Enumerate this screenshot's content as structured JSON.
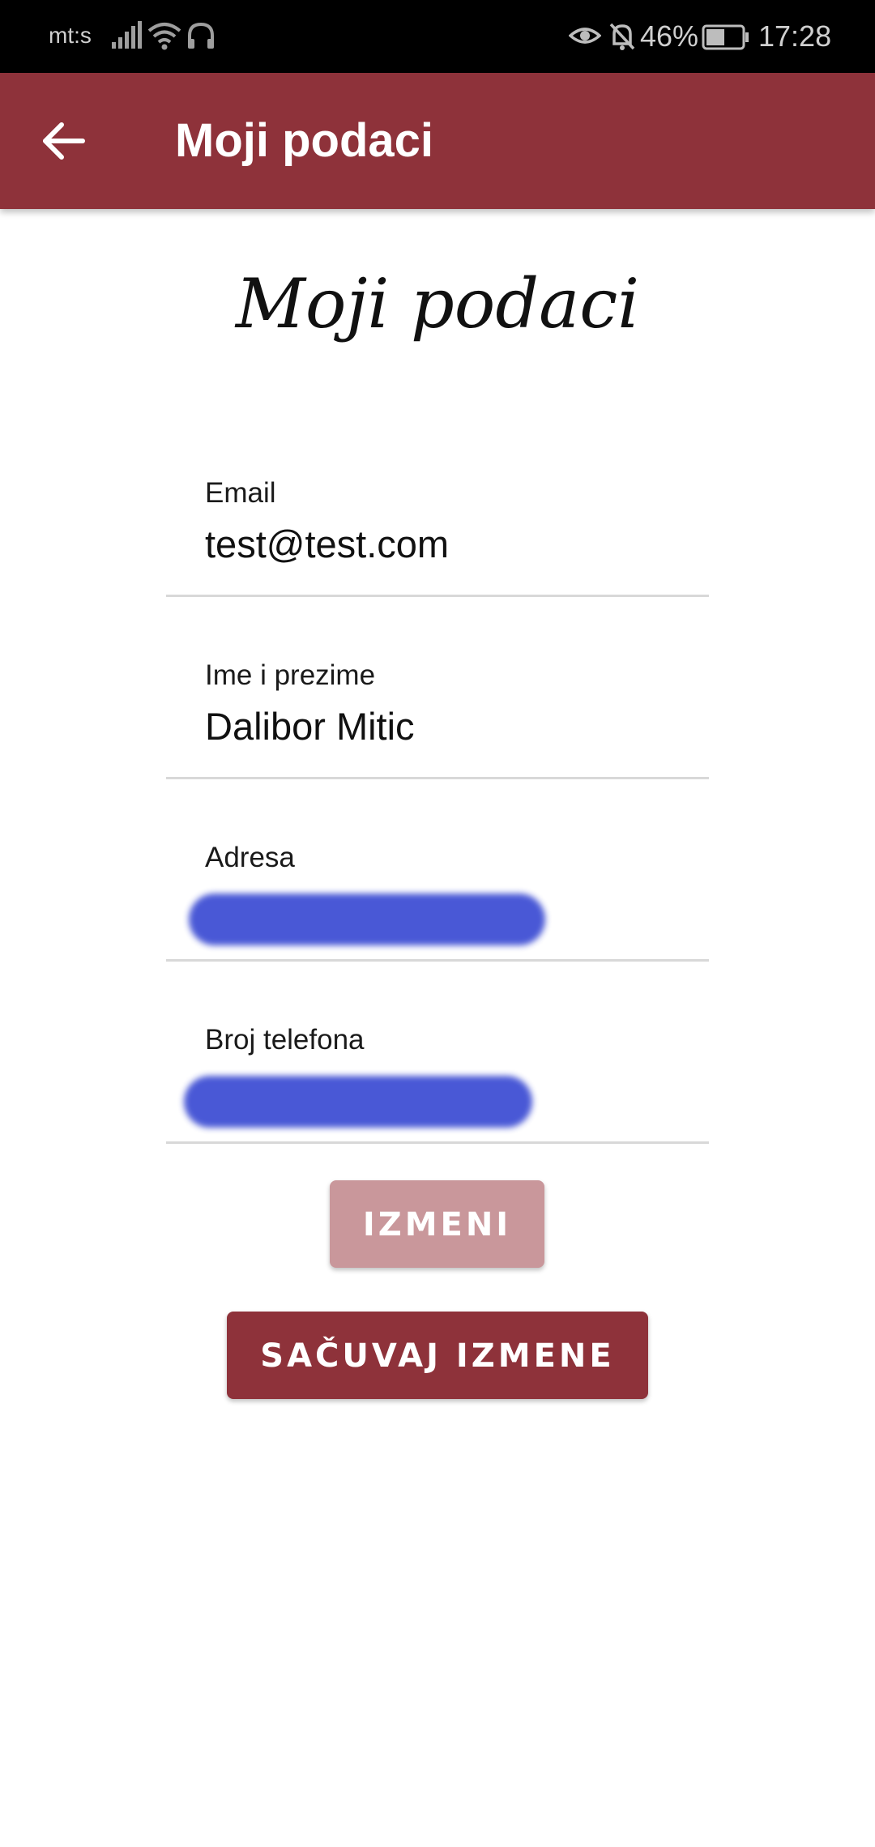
{
  "status_bar": {
    "carrier": "mt:s",
    "battery_percent": "46%",
    "time": "17:28",
    "icons": [
      "signal-icon",
      "wifi-icon",
      "headset-icon",
      "eye-icon",
      "bell-off-icon",
      "battery-icon"
    ]
  },
  "app_bar": {
    "title": "Moji podaci",
    "back_icon": "arrow-left-icon"
  },
  "page": {
    "heading": "Moji podaci"
  },
  "form": {
    "email": {
      "label": "Email",
      "value": "test@test.com"
    },
    "name": {
      "label": "Ime i prezime",
      "value": "Dalibor Mitic"
    },
    "address": {
      "label": "Adresa",
      "value": ""
    },
    "phone": {
      "label": "Broj telefona",
      "value": ""
    }
  },
  "buttons": {
    "edit_label": "IZMENI",
    "save_label": "SAČUVAJ IZMENE"
  },
  "colors": {
    "primary": "#8e323a",
    "primary_disabled": "#c9979b",
    "redaction": "#4050d4"
  }
}
